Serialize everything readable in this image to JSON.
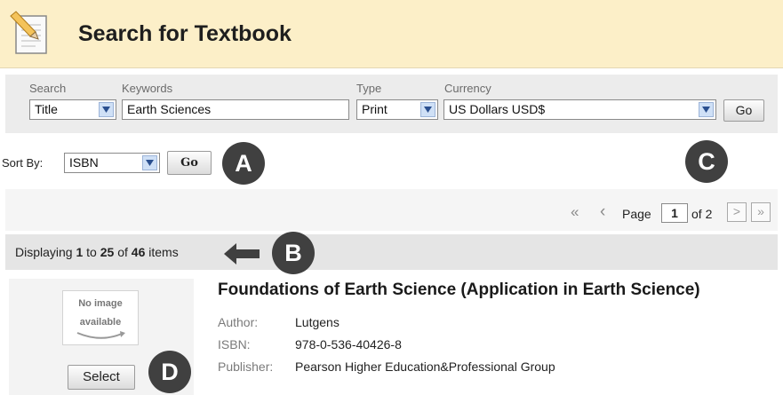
{
  "header": {
    "title": "Search for Textbook",
    "icon": "textbook-edit-icon"
  },
  "search": {
    "search_label": "Search",
    "keywords_label": "Keywords",
    "type_label": "Type",
    "currency_label": "Currency",
    "search_by": "Title",
    "keywords": "Earth Sciences",
    "type": "Print",
    "currency": "US Dollars USD$",
    "go_label": "Go"
  },
  "sort": {
    "label": "Sort By:",
    "value": "ISBN",
    "go_label": "Go"
  },
  "callouts": {
    "a": "A",
    "b": "B",
    "c": "C",
    "d": "D"
  },
  "pager": {
    "first": "«",
    "prev": "‹",
    "page_label": "Page",
    "page": "1",
    "of_label": "of 2",
    "next": ">",
    "last": "»"
  },
  "display": {
    "prefix": "Displaying ",
    "from": "1",
    "to_word": " to ",
    "to": "25",
    "of_word": " of ",
    "total": "46",
    "suffix": " items"
  },
  "result": {
    "title": "Foundations of Earth Science (Application in Earth Science)",
    "no_image_line1": "No image",
    "no_image_line2": "available",
    "author_label": "Author:",
    "author": "Lutgens",
    "isbn_label": "ISBN:",
    "isbn": "978-0-536-40426-8",
    "publisher_label": "Publisher:",
    "publisher": "Pearson Higher Education&Professional Group",
    "select_label": "Select"
  },
  "colors": {
    "header_bg": "#fcefc8",
    "callout": "#404040",
    "select_arrow": "#cfe0f6"
  }
}
